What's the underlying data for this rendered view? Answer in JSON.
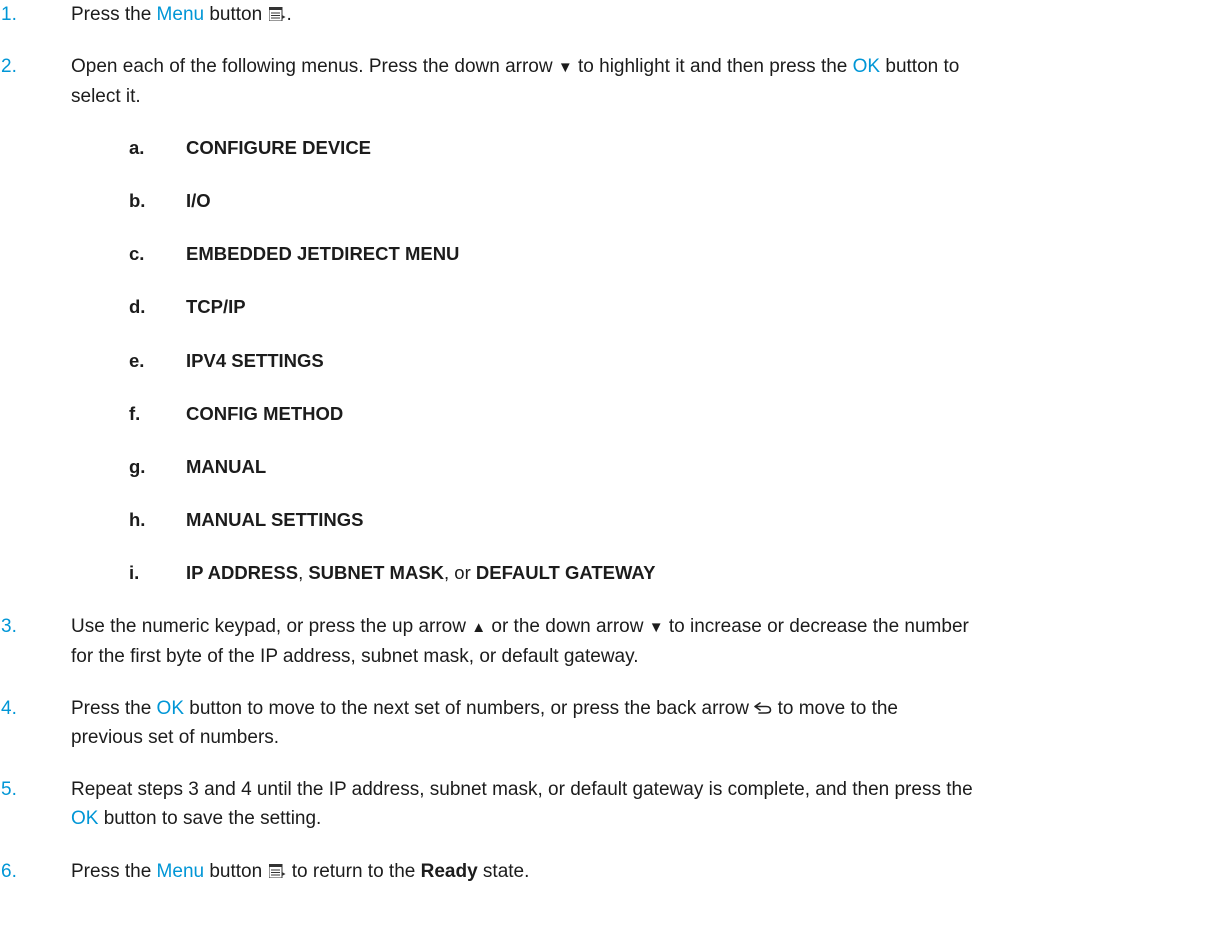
{
  "steps": [
    {
      "num": "1.",
      "parts": {
        "a": "Press the ",
        "b": "Menu",
        "c": " button ",
        "d": "."
      }
    },
    {
      "num": "2.",
      "line1": {
        "a": "Open each of the following menus. Press the down arrow ",
        "arrow": "▼",
        "b": " to highlight it and then press the ",
        "ok": "OK",
        "c": " button to"
      },
      "line2": "select it."
    },
    {
      "num": "3.",
      "line1": {
        "a": "Use the numeric keypad, or press the up arrow ",
        "up": "▲",
        "b": " or the down arrow ",
        "down": "▼",
        "c": " to increase or decrease the number"
      },
      "line2": "for the first byte of the IP address, subnet mask, or default gateway."
    },
    {
      "num": "4.",
      "line1": {
        "a": "Press the ",
        "ok": "OK",
        "b": " button to move to the next set of numbers, or press the back arrow ",
        "c": " to move to the"
      },
      "line2": "previous set of numbers."
    },
    {
      "num": "5.",
      "line1": "Repeat steps 3 and 4 until the IP address, subnet mask, or default gateway is complete, and then press the",
      "line2": {
        "ok": "OK",
        "a": " button to save the setting."
      }
    },
    {
      "num": "6.",
      "parts": {
        "a": "Press the ",
        "b": "Menu",
        "c": " button ",
        "d": " to return to the ",
        "e": "Ready",
        "f": " state."
      }
    }
  ],
  "substeps": [
    {
      "letter": "a.",
      "label": "CONFIGURE DEVICE"
    },
    {
      "letter": "b.",
      "label": "I/O"
    },
    {
      "letter": "c.",
      "label": "EMBEDDED JETDIRECT MENU"
    },
    {
      "letter": "d.",
      "label": "TCP/IP"
    },
    {
      "letter": "e.",
      "label": "IPV4 SETTINGS"
    },
    {
      "letter": "f.",
      "label": "CONFIG METHOD"
    },
    {
      "letter": "g.",
      "label": "MANUAL"
    },
    {
      "letter": "h.",
      "label": "MANUAL SETTINGS"
    },
    {
      "letter": "i.",
      "label_parts": {
        "a": "IP ADDRESS",
        "b": ", ",
        "c": "SUBNET MASK",
        "d": ", or ",
        "e": "DEFAULT GATEWAY"
      }
    }
  ],
  "icons": {
    "menu": "menu-button-icon",
    "back": "back-arrow-icon"
  },
  "colors": {
    "accent": "#0096d6",
    "text": "#1c1c1c"
  }
}
